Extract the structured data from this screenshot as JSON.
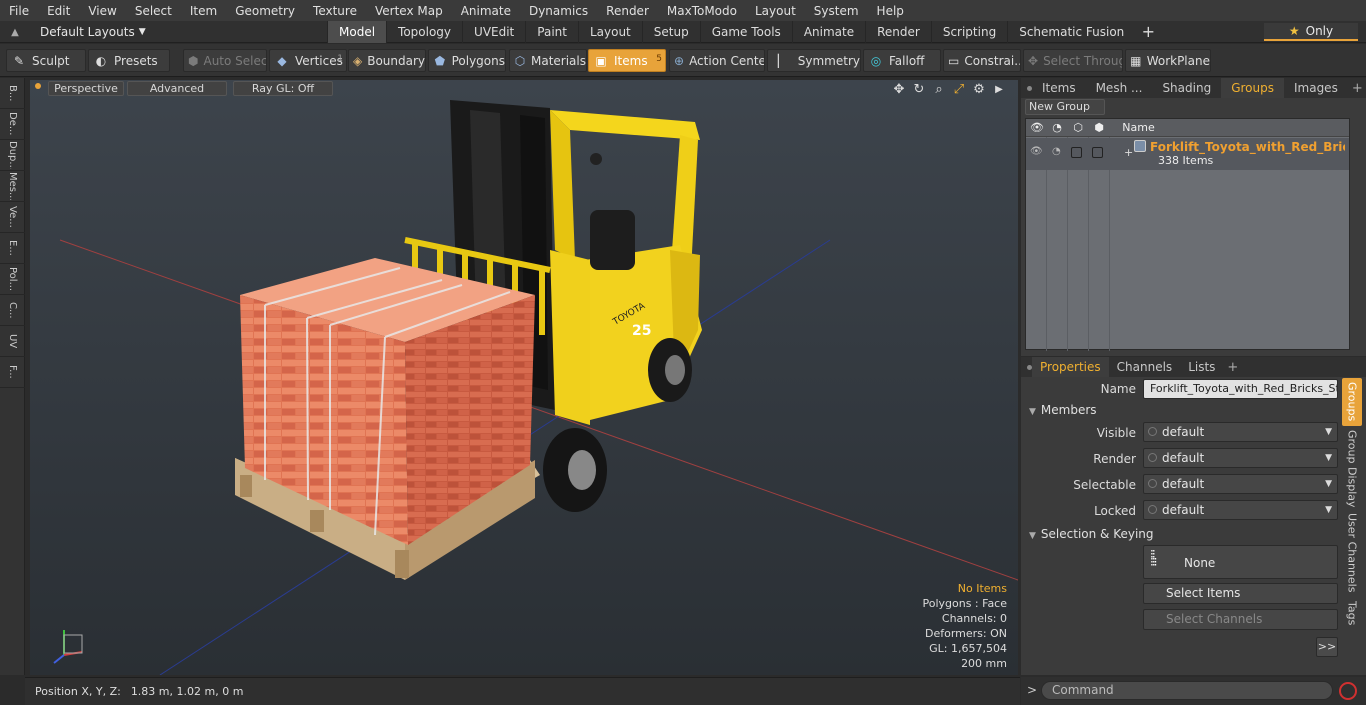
{
  "menu": [
    "File",
    "Edit",
    "View",
    "Select",
    "Item",
    "Geometry",
    "Texture",
    "Vertex Map",
    "Animate",
    "Dynamics",
    "Render",
    "MaxToModo",
    "Layout",
    "System",
    "Help"
  ],
  "layout_menu": "Default Layouts",
  "layout_tabs": [
    "Model",
    "Topology",
    "UVEdit",
    "Paint",
    "Layout",
    "Setup",
    "Game Tools",
    "Animate",
    "Render",
    "Scripting",
    "Schematic Fusion"
  ],
  "active_layout_tab": "Model",
  "only_label": "Only",
  "toolbar": {
    "sculpt": "Sculpt",
    "presets": "Presets",
    "auto_select": "Auto Select",
    "vertices": "Vertices",
    "vertices_count": "1",
    "boundary": "Boundary",
    "polygons": "Polygons",
    "materials": "Materials",
    "items": "Items",
    "items_count": "5",
    "action_center": "Action Center",
    "symmetry": "Symmetry",
    "falloff": "Falloff",
    "constraints": "Constrai...",
    "select_through": "Select Through",
    "workplane": "WorkPlane"
  },
  "left_tabs": [
    "B...",
    "De...",
    "Dup...",
    "Mes...",
    "Ve...",
    "E...",
    "Pol...",
    "C...",
    "UV",
    "F..."
  ],
  "viewport": {
    "perspective": "Perspective",
    "advanced": "Advanced",
    "raygl": "Ray GL: Off",
    "brand_text": "TOYOTA",
    "model_number": "25",
    "stats": {
      "no_items": "No Items",
      "polygons": "Polygons : Face",
      "channels": "Channels: 0",
      "deformers": "Deformers: ON",
      "gl": "GL: 1,657,504",
      "scale": "200 mm"
    }
  },
  "status": {
    "label": "Position X, Y, Z:",
    "value": "1.83 m, 1.02 m, 0 m"
  },
  "right_tabs": [
    "Items",
    "Mesh ...",
    "Shading",
    "Groups",
    "Images"
  ],
  "active_right_tab": "Groups",
  "groups": {
    "new_group": "New Group",
    "col_name": "Name",
    "item_name": "Forklift_Toyota_with_Red_Bricks_Stack",
    "item_count": "338 Items"
  },
  "prop_tabs": [
    "Properties",
    "Channels",
    "Lists"
  ],
  "properties": {
    "name_label": "Name",
    "name_value": "Forklift_Toyota_with_Red_Bricks_Stac",
    "members_title": "Members",
    "visible_label": "Visible",
    "render_label": "Render",
    "selectable_label": "Selectable",
    "locked_label": "Locked",
    "visible_value": "default",
    "render_value": "default",
    "selectable_value": "default",
    "locked_value": "default",
    "sel_keying_title": "Selection & Keying",
    "none_label": "None",
    "select_items": "Select Items",
    "select_channels": "Select Channels",
    "expand_label": ">>"
  },
  "vertical_tabs": [
    "Groups",
    "Group Display",
    "User Channels",
    "Tags"
  ],
  "command": {
    "prompt": ">",
    "placeholder": "Command"
  },
  "colors": {
    "accent": "#e8a33a",
    "selected_text": "#f0a030",
    "brick": "#d9694a",
    "forklift_yellow": "#f2d21e"
  }
}
